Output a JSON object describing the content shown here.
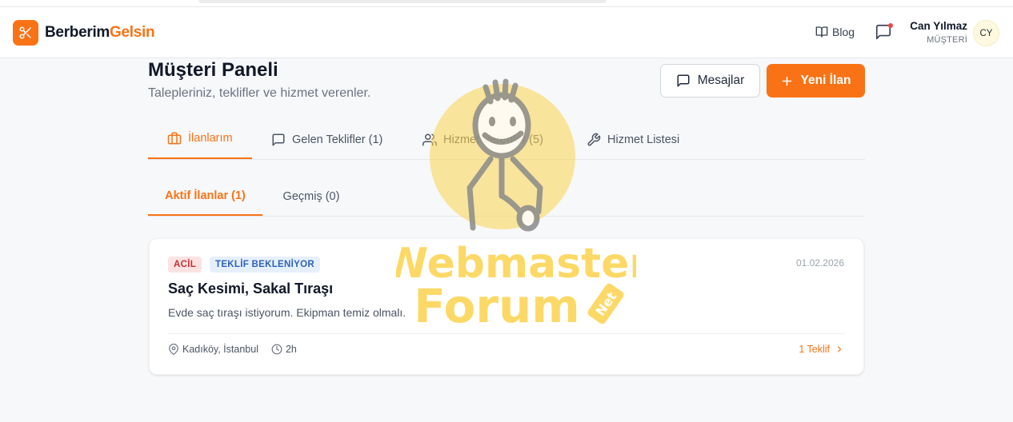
{
  "brand": {
    "name_part1": "Berberim",
    "name_part2": "Gelsin",
    "color": "#f97316"
  },
  "header": {
    "blog_label": "Blog",
    "user": {
      "name": "Can Yılmaz",
      "role": "MÜŞTERİ",
      "initials": "CY"
    }
  },
  "page": {
    "title": "Müşteri Paneli",
    "subtitle": "Talepleriniz, teklifler ve hizmet verenler.",
    "messages_button": "Mesajlar",
    "new_listing_button": "Yeni İlan"
  },
  "tabs": [
    {
      "label": "İlanlarım",
      "icon": "briefcase-icon",
      "active": true
    },
    {
      "label": "Gelen Teklifler (1)",
      "icon": "message-square-icon",
      "active": false
    },
    {
      "label": "Hizmet Verenler (5)",
      "icon": "users-icon",
      "active": false
    },
    {
      "label": "Hizmet Listesi",
      "icon": "wrench-icon",
      "active": false
    }
  ],
  "subtabs": [
    {
      "label": "Aktif İlanlar (1)",
      "active": true
    },
    {
      "label": "Geçmiş (0)",
      "active": false
    }
  ],
  "listing": {
    "badge_urgent": "ACİL",
    "badge_status": "TEKLİF BEKLENİYOR",
    "date": "01.02.2026",
    "title": "Saç Kesimi, Sakal Tıraşı",
    "description": "Evde saç tıraşı istiyorum. Ekipman temiz olmalı.",
    "location": "Kadıköy, İstanbul",
    "time_ago": "2h",
    "offers_link": "1 Teklif"
  },
  "watermark": {
    "line1": "Webmaster",
    "line2": "Forum",
    "tag": "Net"
  }
}
